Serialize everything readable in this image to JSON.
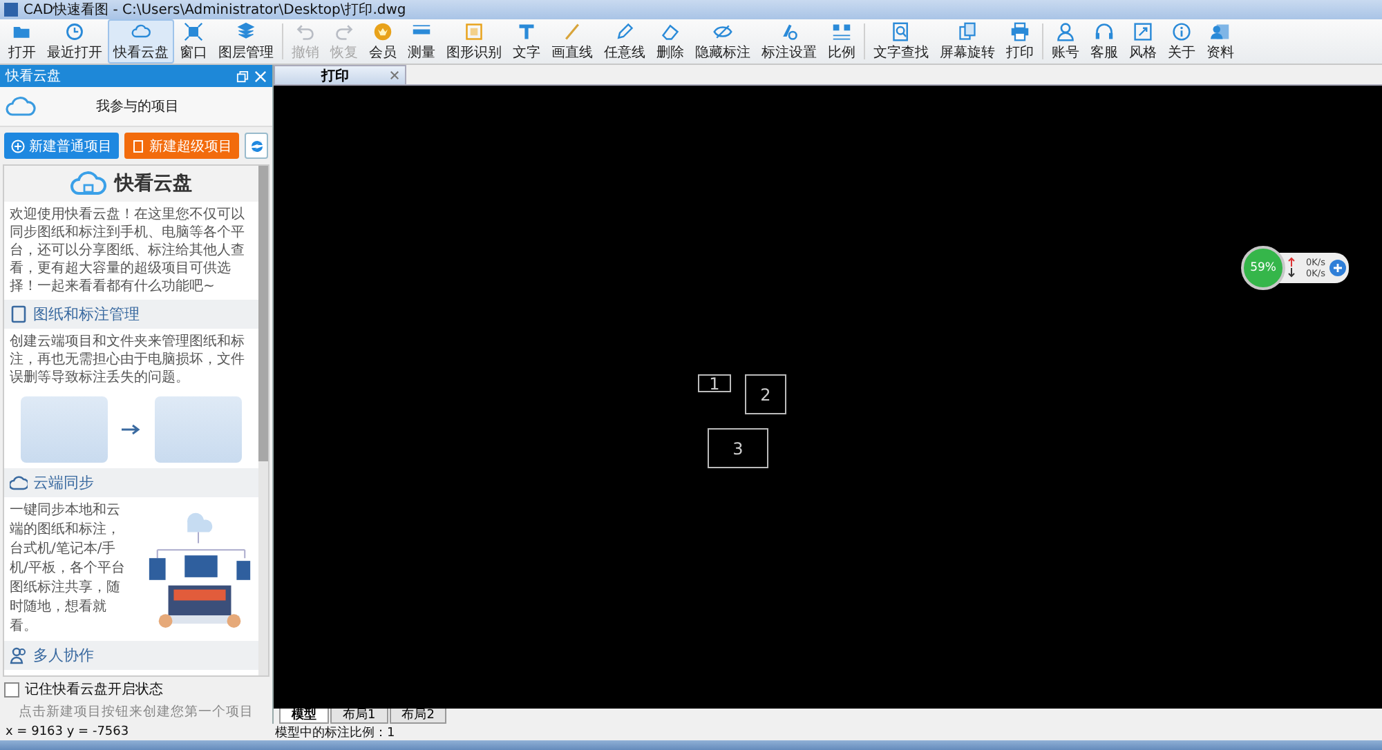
{
  "window": {
    "title": "CAD快速看图 - C:\\Users\\Administrator\\Desktop\\打印.dwg"
  },
  "toolbar": {
    "groups": [
      {
        "items": [
          {
            "label": "打开",
            "selected": false,
            "disabled": false
          },
          {
            "label": "最近打开",
            "selected": false,
            "disabled": false
          },
          {
            "label": "快看云盘",
            "selected": true,
            "disabled": false
          },
          {
            "label": "窗口",
            "selected": false,
            "disabled": false
          },
          {
            "label": "图层管理",
            "selected": false,
            "disabled": false
          }
        ]
      },
      {
        "items": [
          {
            "label": "撤销",
            "selected": false,
            "disabled": true
          },
          {
            "label": "恢复",
            "selected": false,
            "disabled": true
          },
          {
            "label": "会员",
            "selected": false,
            "disabled": false
          },
          {
            "label": "测量",
            "selected": false,
            "disabled": false
          },
          {
            "label": "图形识别",
            "selected": false,
            "disabled": false
          },
          {
            "label": "文字",
            "selected": false,
            "disabled": false
          },
          {
            "label": "画直线",
            "selected": false,
            "disabled": false
          },
          {
            "label": "任意线",
            "selected": false,
            "disabled": false
          },
          {
            "label": "删除",
            "selected": false,
            "disabled": false
          },
          {
            "label": "隐藏标注",
            "selected": false,
            "disabled": false
          },
          {
            "label": "标注设置",
            "selected": false,
            "disabled": false
          },
          {
            "label": "比例",
            "selected": false,
            "disabled": false
          }
        ]
      },
      {
        "items": [
          {
            "label": "文字查找",
            "selected": false,
            "disabled": false
          },
          {
            "label": "屏幕旋转",
            "selected": false,
            "disabled": false
          },
          {
            "label": "打印",
            "selected": false,
            "disabled": false
          }
        ]
      },
      {
        "items": [
          {
            "label": "账号",
            "selected": false,
            "disabled": false
          },
          {
            "label": "客服",
            "selected": false,
            "disabled": false
          },
          {
            "label": "风格",
            "selected": false,
            "disabled": false
          },
          {
            "label": "关于",
            "selected": false,
            "disabled": false
          },
          {
            "label": "资料",
            "selected": false,
            "disabled": false
          }
        ]
      }
    ]
  },
  "cloud_panel": {
    "title": "快看云盘",
    "project_heading": "我参与的项目",
    "buttons": [
      {
        "label": "新建普通项目",
        "kind": "normal"
      },
      {
        "label": "新建超级项目",
        "kind": "super"
      }
    ],
    "intro": {
      "title": "快看云盘",
      "text": "欢迎使用快看云盘！在这里您不仅可以同步图纸和标注到手机、电脑等各个平台，还可以分享图纸、标注给其他人查看，更有超大容量的超级项目可供选择！一起来看看都有什么功能吧~"
    },
    "sections": [
      {
        "title": "图纸和标注管理",
        "text": "创建云端项目和文件夹来管理图纸和标注，再也无需担心由于电脑损坏，文件误删等导致标注丢失的问题。",
        "kind": "below"
      },
      {
        "title": "云端同步",
        "text": "一键同步本地和云端的图纸和标注，台式机/笔记本/手机/平板，各个平台图纸标注共享，随时随地，想看就看。",
        "kind": "beside"
      },
      {
        "title": "多人协作",
        "kind": "none"
      }
    ],
    "remember": {
      "label": "记住快看云盘开启状态",
      "checked": false
    },
    "hint": "点击新建项目按钮来创建您第一个项目"
  },
  "document_tabs": [
    {
      "label": "打印",
      "selected": true
    }
  ],
  "canvas": {
    "shapes": [
      {
        "label": "1"
      },
      {
        "label": "2"
      },
      {
        "label": "3"
      }
    ]
  },
  "net_widget": {
    "percent": "59%",
    "upload": "0K/s",
    "download": "0K/s"
  },
  "layout_tabs": [
    {
      "label": "模型",
      "selected": true
    },
    {
      "label": "布局1",
      "selected": false
    },
    {
      "label": "布局2",
      "selected": false
    }
  ],
  "status_bar": {
    "coordinates": "x = 9163  y = -7563",
    "scale": "模型中的标注比例：1"
  }
}
